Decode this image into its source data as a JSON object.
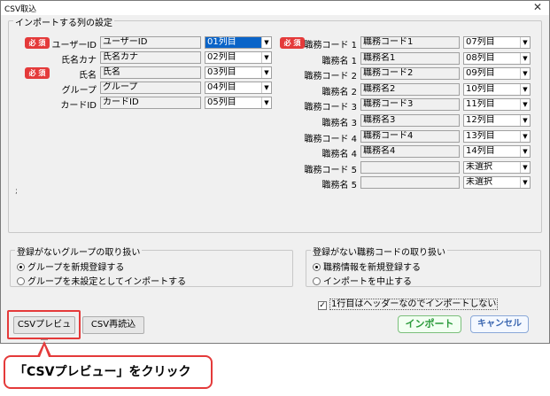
{
  "window": {
    "title": "CSV取込",
    "close_glyph": "✕"
  },
  "import_settings": {
    "title": "インポートする列の設定",
    "required_label": "必 須",
    "left_rows": [
      {
        "label": "ユーザーID",
        "field": "ユーザーID",
        "column": "01列目",
        "required": true,
        "active": true
      },
      {
        "label": "氏名カナ",
        "field": "氏名カナ",
        "column": "02列目",
        "required": false
      },
      {
        "label": "氏名",
        "field": "氏名",
        "column": "03列目",
        "required": true
      },
      {
        "label": "グループ",
        "field": "グループ",
        "column": "04列目",
        "required": false
      },
      {
        "label": "カードID",
        "field": "カードID",
        "column": "05列目",
        "required": false
      }
    ],
    "right_rows": [
      {
        "label": "職務コード 1",
        "field": "職務コード1",
        "column": "07列目",
        "required": true
      },
      {
        "label": "職務名 1",
        "field": "職務名1",
        "column": "08列目"
      },
      {
        "label": "職務コード 2",
        "field": "職務コード2",
        "column": "09列目"
      },
      {
        "label": "職務名 2",
        "field": "職務名2",
        "column": "10列目"
      },
      {
        "label": "職務コード 3",
        "field": "職務コード3",
        "column": "11列目"
      },
      {
        "label": "職務名 3",
        "field": "職務名3",
        "column": "12列目"
      },
      {
        "label": "職務コード 4",
        "field": "職務コード4",
        "column": "13列目"
      },
      {
        "label": "職務名 4",
        "field": "職務名4",
        "column": "14列目"
      },
      {
        "label": "職務コード 5",
        "field": "",
        "column": "未選択"
      },
      {
        "label": "職務名 5",
        "field": "",
        "column": "未選択"
      }
    ],
    "stray_mark": ";"
  },
  "group_handling": {
    "title": "登録がないグループの取り扱い",
    "options": [
      "グループを新規登録する",
      "グループを未設定としてインポートする"
    ],
    "selected": 0
  },
  "job_handling": {
    "title": "登録がない職務コードの取り扱い",
    "options": [
      "職務情報を新規登録する",
      "インポートを中止する"
    ],
    "selected": 0
  },
  "header_checkbox": {
    "label": "1行目はヘッダーなのでインポートしない",
    "checked_glyph": "✓"
  },
  "buttons": {
    "csv_preview": "CSVプレビュー",
    "csv_reload": "CSV再読込",
    "import": "インポート",
    "cancel": "キャンセル"
  },
  "callout": {
    "text": "「CSVプレビュー」をクリック"
  },
  "colors": {
    "required": "#e43a3a",
    "highlight": "#e43a3a",
    "import": "#2a9a3a",
    "cancel": "#3a66b0",
    "active_select": "#0a64c8"
  },
  "icons": {
    "dropdown": "chevron-down-icon",
    "close": "close-icon"
  }
}
